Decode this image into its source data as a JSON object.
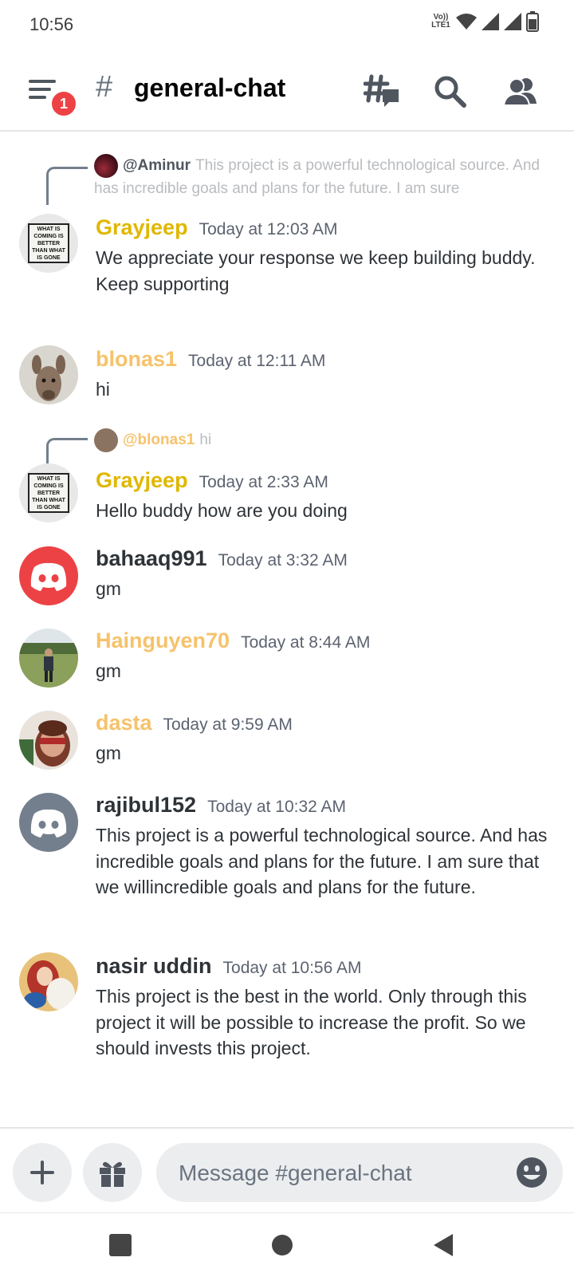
{
  "status_bar": {
    "time": "10:56",
    "volte_top": "Vo))",
    "volte_bottom": "LTE1"
  },
  "header": {
    "hash": "#",
    "channel_name": "general-chat",
    "notification_count": "1"
  },
  "messages": [
    {
      "reply": {
        "author": "@Aminur",
        "text": "This project is a powerful technological source. And has incredible goals and plans for the future. I am sure"
      },
      "author": "Grayjeep",
      "author_color": "#e0b700",
      "timestamp": "Today at 12:03 AM",
      "lines": [
        "We appreciate your response we keep building buddy.",
        "Keep supporting"
      ],
      "avatar_sign": "WHAT IS COMING IS BETTER THAN WHAT IS GONE"
    },
    {
      "author": "blonas1",
      "author_color": "#f6c26b",
      "timestamp": "Today at 12:11 AM",
      "text": "hi"
    },
    {
      "reply": {
        "author": "@blonas1",
        "text": "hi"
      },
      "author": "Grayjeep",
      "author_color": "#e0b700",
      "timestamp": "Today at 2:33 AM",
      "text": "Hello buddy how are you doing",
      "avatar_sign": "WHAT IS COMING IS BETTER THAN WHAT IS GONE"
    },
    {
      "author": "bahaaq991",
      "author_color": "#2e3338",
      "timestamp": "Today at 3:32 AM",
      "text": "gm"
    },
    {
      "author": "Hainguyen70",
      "author_color": "#f6c26b",
      "timestamp": "Today at 8:44 AM",
      "text": "gm"
    },
    {
      "author": "dasta",
      "author_color": "#f6c26b",
      "timestamp": "Today at 9:59 AM",
      "text": "gm"
    },
    {
      "author": "rajibul152",
      "author_color": "#2e3338",
      "timestamp": "Today at 10:32 AM",
      "text": "This project is a powerful technological source. And has incredible goals and plans for the future. I am sure that we willincredible goals and plans for the future."
    },
    {
      "author": "nasir uddin",
      "author_color": "#2e3338",
      "timestamp": "Today at 10:56 AM",
      "text": "This project is the best in the world. Only through this project it will be possible to increase the profit. So we should invests this project."
    }
  ],
  "composer": {
    "placeholder": "Message #general-chat"
  },
  "colors": {
    "discord_red": "#ed4245",
    "discord_grey": "#747f8d",
    "accent_yellow": "#e0b700",
    "accent_orange": "#f6c26b"
  },
  "icons": [
    "menu-icon",
    "threads-icon",
    "search-icon",
    "members-icon",
    "plus-icon",
    "gift-icon",
    "emoji-icon",
    "nav-recents-icon",
    "nav-home-icon",
    "nav-back-icon"
  ]
}
